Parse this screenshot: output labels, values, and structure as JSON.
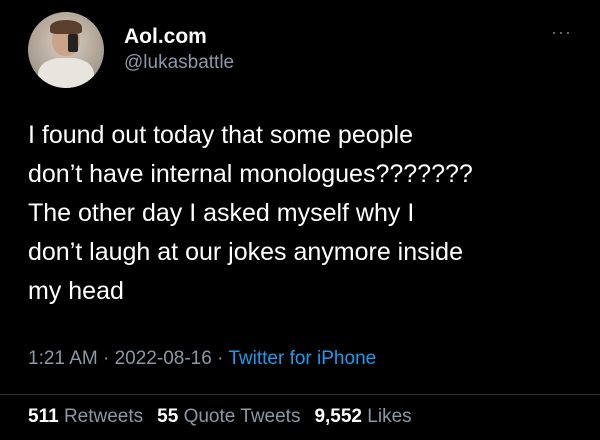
{
  "tweet": {
    "display_name": "Aol.com",
    "handle": "@lukasbattle",
    "text": "I found out today that some people\ndon’t have internal monologues???????\nThe other day I asked myself why I\ndon’t laugh at our jokes anymore inside\nmy head",
    "time": "1:21 AM",
    "separator": "·",
    "date": "2022-08-16",
    "source": "Twitter for iPhone",
    "more_icon": "···",
    "retweets_count": "511",
    "retweets_label": "Retweets",
    "quote_tweets_count": "55",
    "quote_tweets_label": "Quote Tweets",
    "likes_count": "9,552",
    "likes_label": "Likes"
  },
  "colors": {
    "background": "#000000",
    "primary_text": "#ffffff",
    "secondary_text": "#8b98a5",
    "link": "#1d9bf0",
    "divider": "#2f3336"
  },
  "icons": {
    "more": "ellipsis-icon"
  }
}
